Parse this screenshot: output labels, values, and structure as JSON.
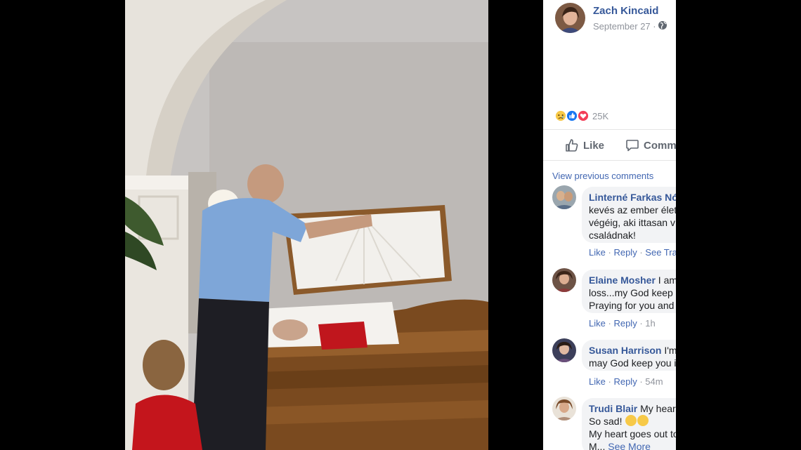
{
  "post": {
    "author": "Zach Kincaid",
    "date": "September 27",
    "date_sep": "·",
    "reaction_count": "25K",
    "actions": {
      "like": "Like",
      "comment": "Comm"
    }
  },
  "comments_section": {
    "view_previous": "View previous comments",
    "comments": [
      {
        "name": "Linterné Farkas Nó",
        "text_lines": [
          "kevés az ember élet",
          "végéig, aki ittasan v",
          "családnak!"
        ],
        "actions": [
          "Like",
          "Reply",
          "See Tra"
        ],
        "time": ""
      },
      {
        "name": "Elaine Mosher",
        "first_line_rest": " I am",
        "text_lines": [
          "loss...my God keep",
          "Praying for you and"
        ],
        "actions": [
          "Like",
          "Reply"
        ],
        "time": "1h"
      },
      {
        "name": "Susan Harrison",
        "first_line_rest": " I'm",
        "text_lines": [
          "may God keep you i"
        ],
        "actions": [
          "Like",
          "Reply"
        ],
        "time": "54m"
      },
      {
        "name": "Trudi Blair",
        "first_line_rest": " My hear",
        "text_lines": [
          "So sad!",
          "My heart goes out to",
          "M..."
        ],
        "see_more": "See More"
      }
    ],
    "separator": "·"
  },
  "colors": {
    "fb_link": "#365899",
    "fb_blue": "#4267b2",
    "meta_gray": "#90949c",
    "bubble_bg": "#f2f3f5"
  },
  "icons": [
    "globe-icon",
    "sad-reaction-icon",
    "like-reaction-icon",
    "love-reaction-icon",
    "thumbs-up-icon",
    "comment-icon"
  ]
}
